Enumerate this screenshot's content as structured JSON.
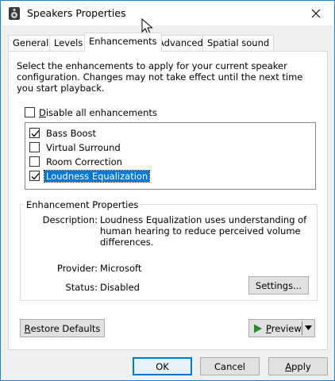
{
  "window": {
    "title": "Speakers Properties",
    "colors": {
      "accent": "#0078d7",
      "border": "#1883d7",
      "titlebar": "#ffffff",
      "face": "#f0f0f0"
    }
  },
  "tabs": [
    {
      "label": "General",
      "active": false
    },
    {
      "label": "Levels",
      "active": false
    },
    {
      "label": "Enhancements",
      "active": true
    },
    {
      "label": "Advanced",
      "active": false
    },
    {
      "label": "Spatial sound",
      "active": false
    }
  ],
  "enhancements": {
    "description": "Select the enhancements to apply for your current speaker configuration. Changes may not take effect until the next time you start playback.",
    "disable_all": {
      "label_underlined": "D",
      "label_rest": "isable all enhancements",
      "checked": false
    },
    "items": [
      {
        "label": "Bass Boost",
        "checked": true,
        "selected": false
      },
      {
        "label": "Virtual Surround",
        "checked": false,
        "selected": false
      },
      {
        "label": "Room Correction",
        "checked": false,
        "selected": false
      },
      {
        "label": "Loudness Equalization",
        "checked": true,
        "selected": true
      }
    ]
  },
  "properties": {
    "group_title": "Enhancement Properties",
    "description_label": "Description:",
    "description_value": "Loudness Equalization uses understanding of human hearing to reduce perceived volume differences.",
    "provider_label": "Provider:",
    "provider_value": "Microsoft",
    "status_label": "Status:",
    "status_value": "Disabled",
    "settings_button": "Settings..."
  },
  "buttons": {
    "restore_underlined": "R",
    "restore_rest": "estore Defaults",
    "preview_underlined": "P",
    "preview_rest": "review",
    "ok": "OK",
    "cancel": "Cancel",
    "apply_underlined": "A",
    "apply_rest": "pply"
  },
  "icons": {
    "title_icon": "speaker-icon",
    "close": "close-icon",
    "cursor": "mouse-pointer-icon",
    "play": "play-icon",
    "dropdown": "dropdown-arrow-icon"
  }
}
